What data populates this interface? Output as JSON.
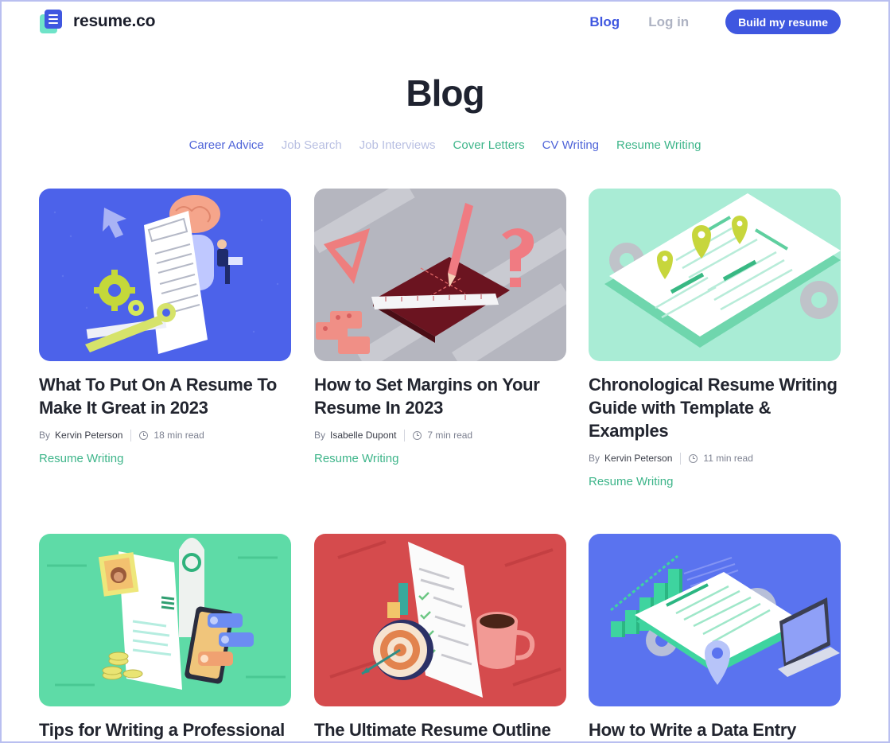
{
  "brand": {
    "name": "resume.co"
  },
  "nav": {
    "blog": "Blog",
    "login": "Log in",
    "cta": "Build my resume"
  },
  "page": {
    "title": "Blog"
  },
  "categories": [
    {
      "label": "Career Advice"
    },
    {
      "label": "Job Search"
    },
    {
      "label": "Job Interviews"
    },
    {
      "label": "Cover Letters"
    },
    {
      "label": "CV Writing"
    },
    {
      "label": "Resume Writing"
    }
  ],
  "posts": [
    {
      "title": "What To Put On A Resume To Make It Great in 2023",
      "by": "By",
      "author": "Kervin Peterson",
      "read_time": "18 min read",
      "tag": "Resume Writing",
      "image": "resume-brain-gear-illustration"
    },
    {
      "title": "How to Set Margins on Your Resume In 2023",
      "by": "By",
      "author": "Isabelle Dupont",
      "read_time": "7 min read",
      "tag": "Resume Writing",
      "image": "ruler-pencil-margins-illustration"
    },
    {
      "title": "Chronological Resume Writing Guide with Template & Examples",
      "by": "By",
      "author": "Kervin Peterson",
      "read_time": "11 min read",
      "tag": "Resume Writing",
      "image": "timeline-map-pins-illustration"
    },
    {
      "title": "Tips for Writing a Professional",
      "image": "rocket-phone-resume-illustration"
    },
    {
      "title": "The Ultimate Resume Outline",
      "image": "target-checklist-coffee-illustration"
    },
    {
      "title": "How to Write a Data Entry",
      "image": "bar-chart-laptop-illustration"
    }
  ],
  "colors": {
    "accent": "#3f57e0",
    "green": "#3eb58a",
    "faded": "#b8bfe2"
  }
}
